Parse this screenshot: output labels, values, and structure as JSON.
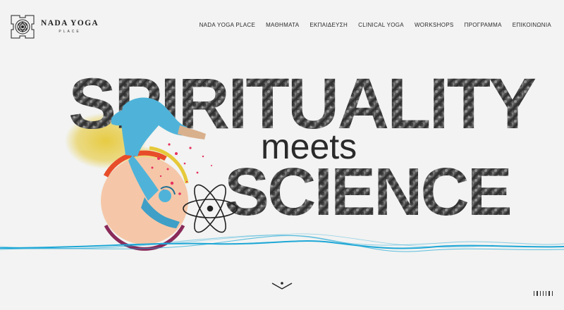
{
  "brand": {
    "name": "NADA YOGA",
    "tagline": "PLACE"
  },
  "nav": [
    "NADA YOGA PLACE",
    "ΜΑΘΗΜΑΤΑ",
    "ΕΚΠΑΙΔΕΥΣΗ",
    "CLINICAL YOGA",
    "WORKSHOPS",
    "ΠΡΟΓΡΑΜΜΑ",
    "ΕΠΙΚΟΙΝΩΝΙΑ"
  ],
  "hero": {
    "line1": "SPIRITUALITY",
    "line2": "meets",
    "line3": "SCIENCE"
  },
  "colors": {
    "accent": "#1ea7d6",
    "yellow": "#e6c93a",
    "pink": "#e8305f",
    "figure": "#4fb3d9",
    "ink": "#222222"
  },
  "icons": [
    "yantra-logo-icon",
    "atom-icon",
    "chevron-down-icon",
    "slide-ticks-icon"
  ]
}
